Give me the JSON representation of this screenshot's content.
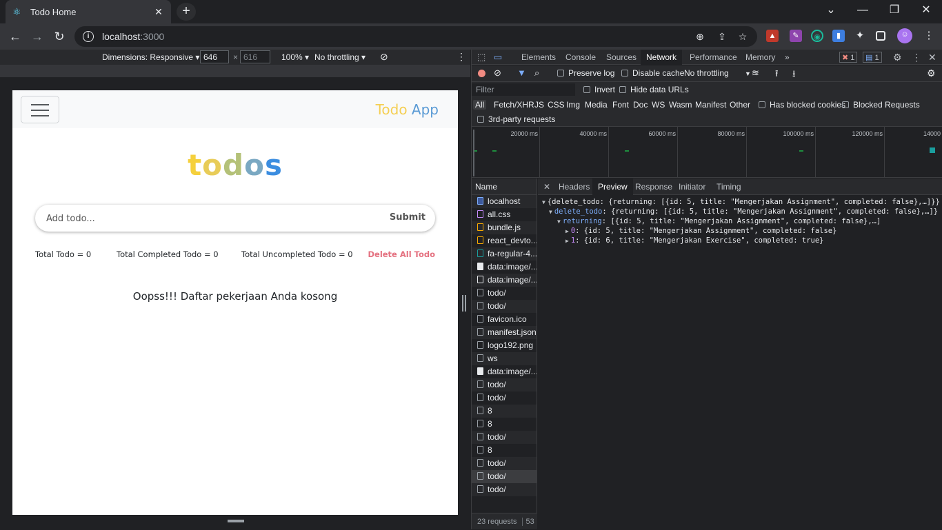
{
  "browser": {
    "tab_title": "Todo Home",
    "url_host": "localhost",
    "url_port": ":3000"
  },
  "device_toolbar": {
    "dimensions_label": "Dimensions: Responsive ▾",
    "width": "646",
    "height": "616",
    "zoom": "100% ▾",
    "throttling": "No throttling ▾"
  },
  "app": {
    "brand_part1": "Todo",
    "brand_part2": "App",
    "logo_letters": [
      "t",
      "o",
      "d",
      "o",
      "s"
    ],
    "input_placeholder": "Add todo...",
    "submit_label": "Submit",
    "total_todo": "Total Todo = 0",
    "total_completed": "Total Completed Todo = 0",
    "total_uncompleted": "Total Uncompleted Todo = 0",
    "delete_all": "Delete All Todo",
    "empty_message": "Oopss!!! Daftar pekerjaan Anda kosong"
  },
  "devtools": {
    "tabs": [
      "Elements",
      "Console",
      "Sources",
      "Network",
      "Performance",
      "Memory"
    ],
    "active_tab": "Network",
    "error_count": "1",
    "message_count": "1",
    "preserve_log": "Preserve log",
    "disable_cache": "Disable cache",
    "throttle": "No throttling",
    "filter_placeholder": "Filter",
    "invert": "Invert",
    "hide_data_urls": "Hide data URLs",
    "types": [
      "All",
      "Fetch/XHR",
      "JS",
      "CSS",
      "Img",
      "Media",
      "Font",
      "Doc",
      "WS",
      "Wasm",
      "Manifest",
      "Other"
    ],
    "has_blocked_cookies": "Has blocked cookies",
    "blocked_requests": "Blocked Requests",
    "third_party": "3rd-party requests",
    "timeline_ticks": [
      "20000 ms",
      "40000 ms",
      "60000 ms",
      "80000 ms",
      "100000 ms",
      "120000 ms",
      "14000"
    ],
    "name_header": "Name",
    "requests": [
      "localhost",
      "all.css",
      "bundle.js",
      "react_devto...",
      "fa-regular-4...",
      "data:image/...",
      "data:image/...",
      "todo/",
      "todo/",
      "favicon.ico",
      "manifest.json",
      "logo192.png",
      "ws",
      "data:image/...",
      "todo/",
      "todo/",
      "8",
      "8",
      "todo/",
      "8",
      "todo/",
      "todo/",
      "todo/"
    ],
    "footer": "23 requests",
    "footer_extra": "53",
    "preview_tabs": [
      "Headers",
      "Preview",
      "Response",
      "Initiator",
      "Timing"
    ],
    "active_preview_tab": "Preview",
    "json_lines": {
      "root": "{delete_todo: {returning: [{id: 5, title: \"Mengerjakan Assignment\", completed: false},…]}}",
      "delete_todo_key": "delete_todo",
      "delete_todo_val": ": {returning: [{id: 5, title: \"Mengerjakan Assignment\", completed: false},…]}",
      "returning_key": "returning",
      "returning_val": ": [{id: 5, title: \"Mengerjakan Assignment\", completed: false},…]",
      "item0_key": "0",
      "item0_val": ": {id: 5, title: \"Mengerjakan Assignment\", completed: false}",
      "item1_key": "1",
      "item1_val": ": {id: 6, title: \"Mengerjakan Exercise\", completed: true}"
    }
  }
}
